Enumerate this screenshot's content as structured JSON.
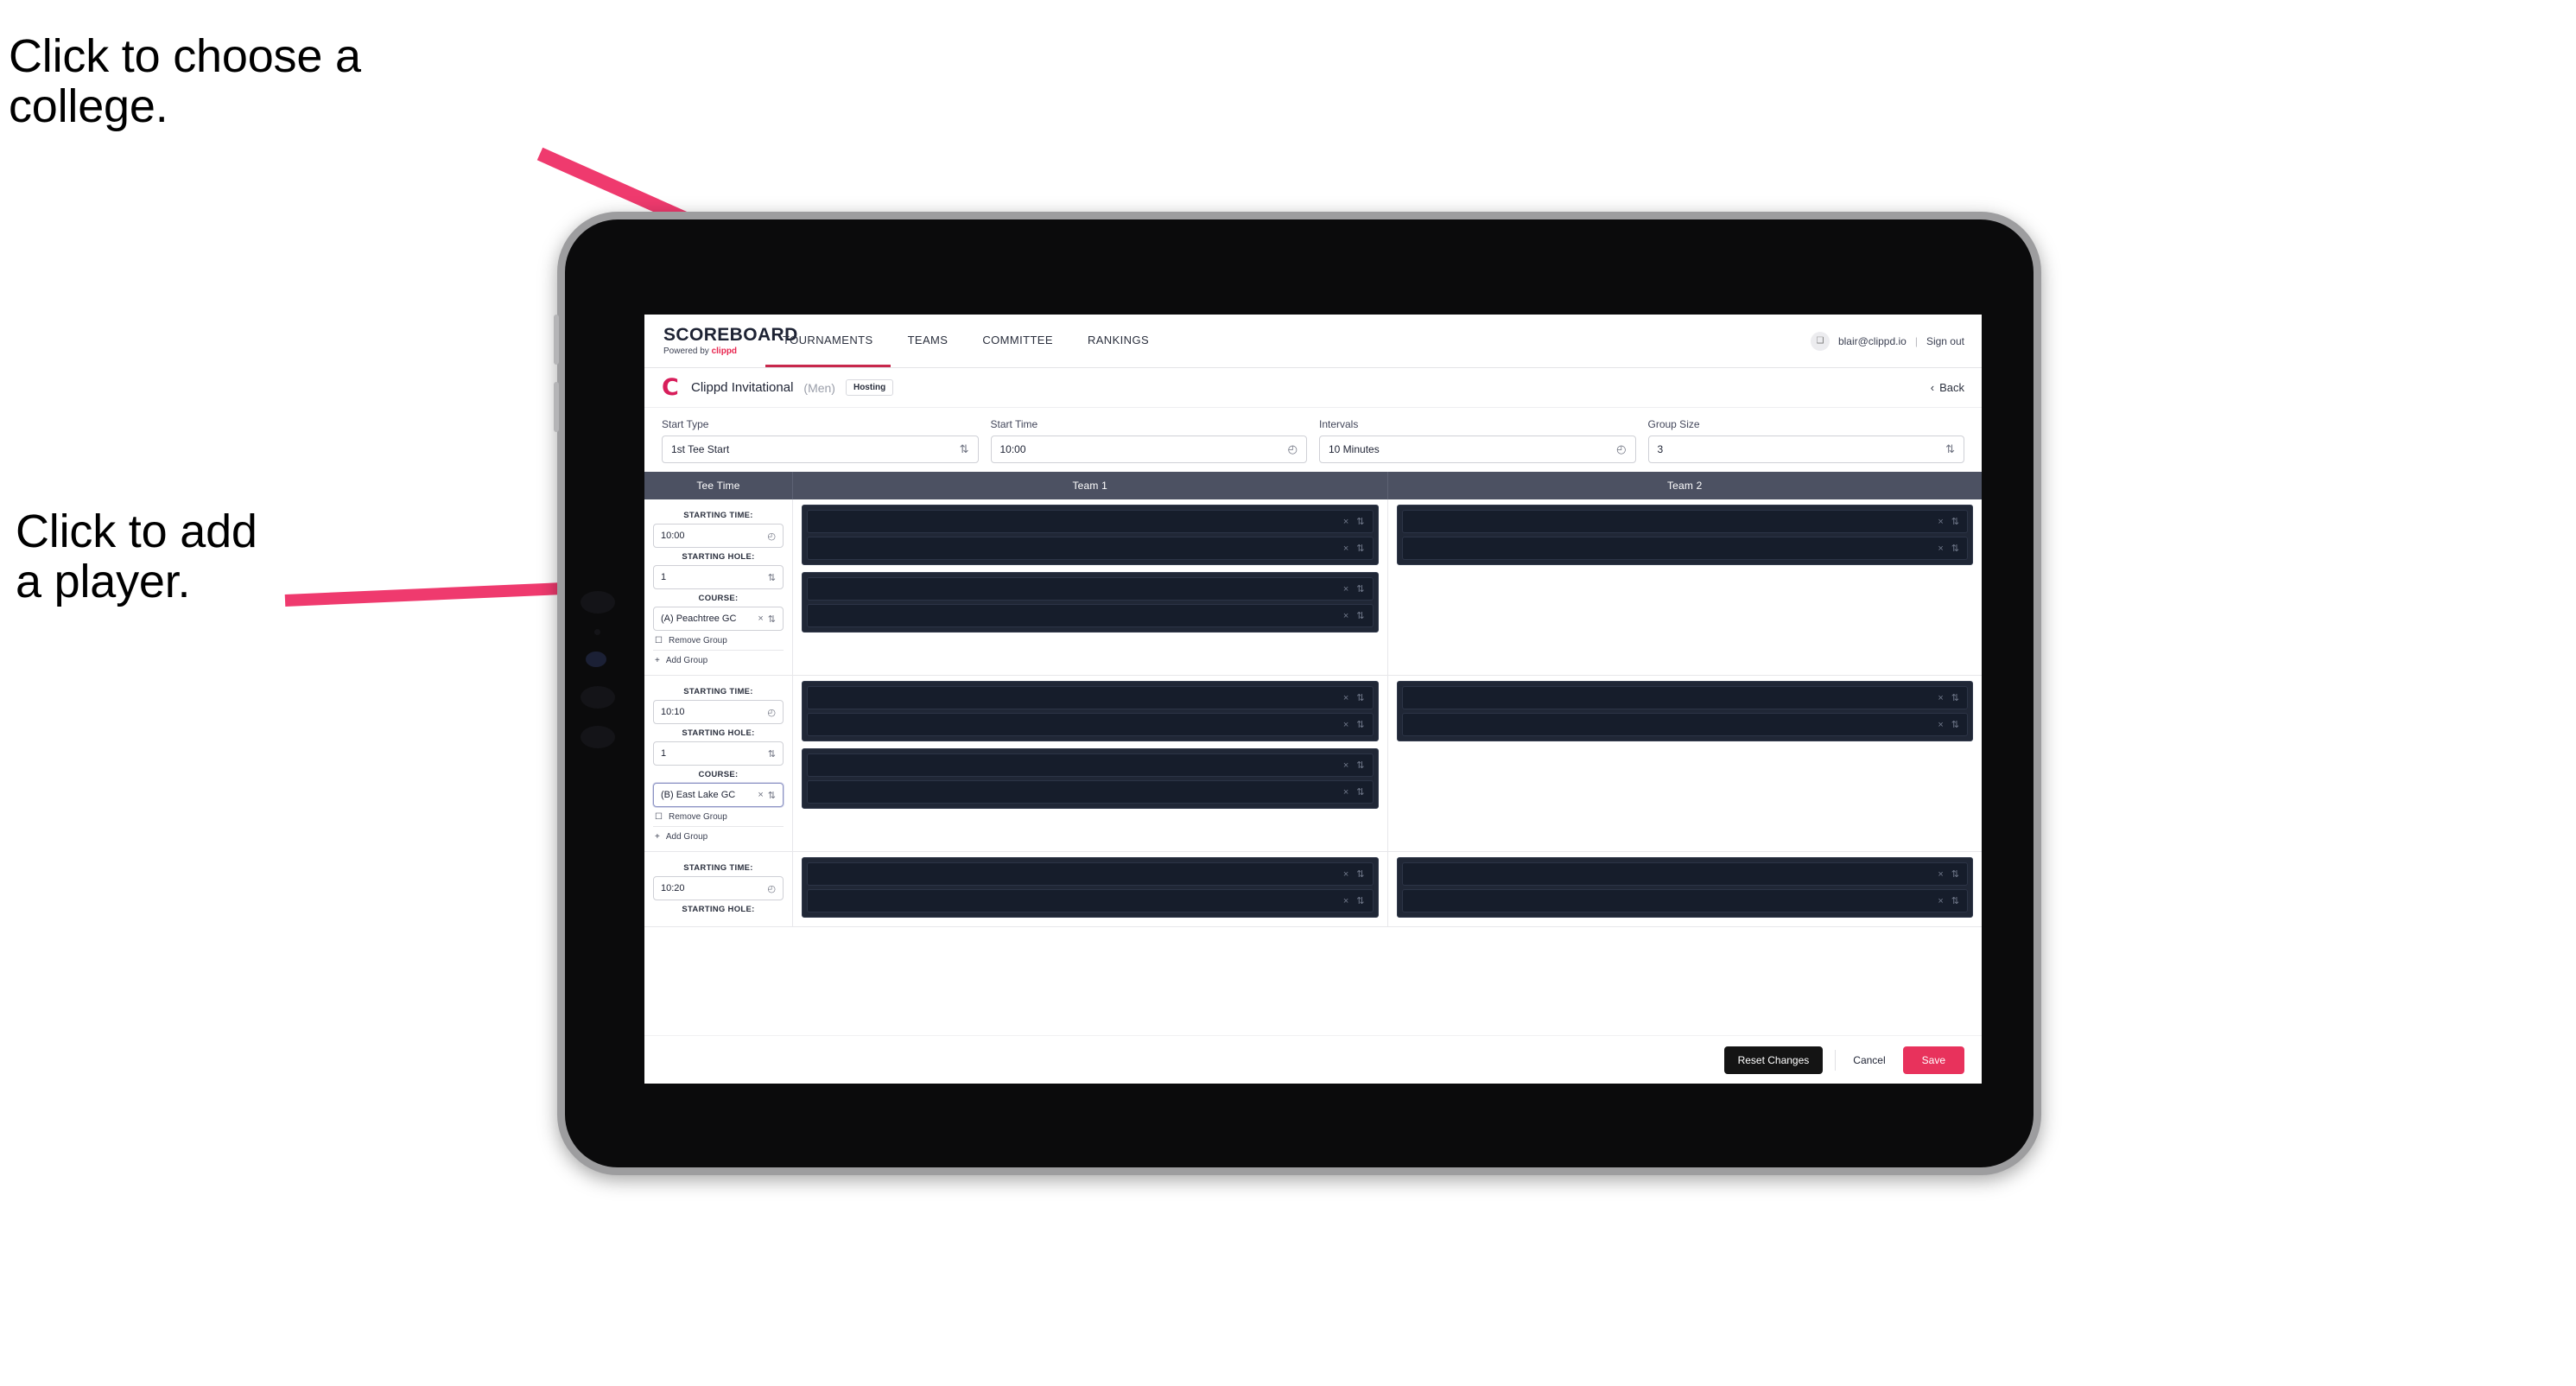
{
  "annotations": {
    "college": "Click to choose a\ncollege.",
    "player": "Click to add\na player."
  },
  "colors": {
    "accent_pink": "#e8325c",
    "arrow_pink": "#ef3a6e",
    "header_slate": "#4c5162",
    "redacted_dark": "#161d2b"
  },
  "topnav": {
    "brand_title": "SCOREBOARD",
    "brand_sub_prefix": "Powered by ",
    "brand_sub_brand": "clippd",
    "tabs": [
      {
        "label": "TOURNAMENTS",
        "active": true
      },
      {
        "label": "TEAMS",
        "active": false
      },
      {
        "label": "COMMITTEE",
        "active": false
      },
      {
        "label": "RANKINGS",
        "active": false
      }
    ],
    "avatar_glyph": "❑",
    "user_email": "blair@clippd.io",
    "separator": "|",
    "sign_out": "Sign out"
  },
  "eventbar": {
    "logo_letter": "C",
    "event_name": "Clippd Invitational",
    "gender": "(Men)",
    "status_pill": "Hosting",
    "back_chevron": "‹",
    "back_label": "Back"
  },
  "filters": [
    {
      "label": "Start Type",
      "value": "1st Tee Start",
      "adorn": "stepper-icon",
      "adorn_glyph": "⇅"
    },
    {
      "label": "Start Time",
      "value": "10:00",
      "adorn": "clock-icon",
      "adorn_glyph": "◴"
    },
    {
      "label": "Intervals",
      "value": "10 Minutes",
      "adorn": "clock-icon",
      "adorn_glyph": "◴"
    },
    {
      "label": "Group Size",
      "value": "3",
      "adorn": "stepper-icon",
      "adorn_glyph": "⇅"
    }
  ],
  "table": {
    "headers": [
      "Tee Time",
      "Team 1",
      "Team 2"
    ],
    "sublabels": {
      "time": "STARTING TIME:",
      "hole": "STARTING HOLE:",
      "course": "COURSE:"
    },
    "group_actions": {
      "remove_icon": "trash-icon",
      "remove_glyph": "☐",
      "remove_label": "Remove Group",
      "add_icon": "plus-icon",
      "add_glyph": "+",
      "add_label": "Add Group"
    },
    "row_icons": {
      "clear_glyph": "×",
      "stepper_glyph": "⇅"
    },
    "rows": [
      {
        "starting_time": "10:00",
        "starting_hole": "1",
        "course": "(A) Peachtree GC",
        "course_focused": false,
        "team1_groups": [
          2,
          2
        ],
        "team2_groups": [
          2
        ]
      },
      {
        "starting_time": "10:10",
        "starting_hole": "1",
        "course": "(B) East Lake GC",
        "course_focused": true,
        "team1_groups": [
          2,
          2
        ],
        "team2_groups": [
          2
        ]
      },
      {
        "starting_time": "10:20",
        "starting_hole": "",
        "course": "",
        "course_focused": false,
        "team1_groups": [
          2
        ],
        "team2_groups": [
          2
        ],
        "partial": true
      }
    ]
  },
  "footer": {
    "reset_label": "Reset Changes",
    "cancel_label": "Cancel",
    "save_label": "Save"
  }
}
